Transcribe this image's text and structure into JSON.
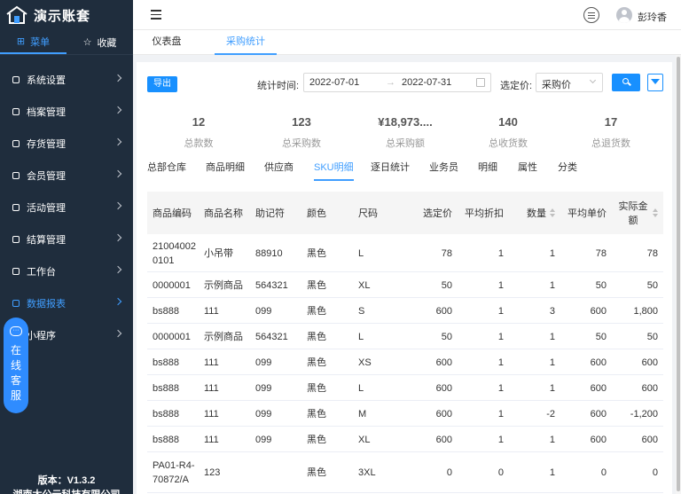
{
  "app": {
    "name": "演示账套",
    "version": "版本：V1.3.2",
    "company": "湖南太公云科技有限公司"
  },
  "sidebar": {
    "switch_tabs": [
      {
        "label": "菜单",
        "icon": "grid-icon",
        "active": true
      },
      {
        "label": "收藏",
        "icon": "star-icon",
        "active": false
      }
    ],
    "items": [
      {
        "label": "系统设置",
        "icon": "settings-icon"
      },
      {
        "label": "档案管理",
        "icon": "archive-icon"
      },
      {
        "label": "存货管理",
        "icon": "inventory-icon"
      },
      {
        "label": "会员管理",
        "icon": "member-icon"
      },
      {
        "label": "活动管理",
        "icon": "activity-icon"
      },
      {
        "label": "结算管理",
        "icon": "settlement-icon"
      },
      {
        "label": "工作台",
        "icon": "workbench-icon"
      },
      {
        "label": "数据报表",
        "icon": "report-icon",
        "active": true
      },
      {
        "label": "小程序",
        "icon": "miniapp-icon"
      }
    ],
    "service": "在线客服"
  },
  "header": {
    "username": "彭玲香"
  },
  "page_tabs": [
    {
      "label": "仪表盘",
      "active": false
    },
    {
      "label": "采购统计",
      "active": true
    }
  ],
  "toolbar": {
    "export_label": "导出",
    "time_label": "统计时间:",
    "start_date": "2022-07-01",
    "end_date": "2022-07-31",
    "arrow": "→",
    "price_label": "选定价:",
    "price_value": "采购价"
  },
  "stats": [
    {
      "value": "12",
      "label": "总款数"
    },
    {
      "value": "123",
      "label": "总采购数"
    },
    {
      "value": "¥18,973....",
      "label": "总采购额"
    },
    {
      "value": "140",
      "label": "总收货数"
    },
    {
      "value": "17",
      "label": "总退货数"
    }
  ],
  "sub_tabs": [
    {
      "label": "总部仓库",
      "active": false
    },
    {
      "label": "商品明细",
      "active": false
    },
    {
      "label": "供应商",
      "active": false
    },
    {
      "label": "SKU明细",
      "active": true
    },
    {
      "label": "逐日统计",
      "active": false
    },
    {
      "label": "业务员",
      "active": false
    },
    {
      "label": "明细",
      "active": false
    },
    {
      "label": "属性",
      "active": false
    },
    {
      "label": "分类",
      "active": false
    }
  ],
  "table": {
    "columns": [
      "商品编码",
      "商品名称",
      "助记符",
      "颜色",
      "尺码",
      "选定价",
      "平均折扣",
      "数量",
      "平均单价",
      "实际金额"
    ],
    "rows": [
      [
        "21004002 0101",
        "小吊带",
        "88910",
        "黑色",
        "L",
        "78",
        "1",
        "1",
        "78",
        "78"
      ],
      [
        "0000001",
        "示例商品",
        "564321",
        "黑色",
        "XL",
        "50",
        "1",
        "1",
        "50",
        "50"
      ],
      [
        "bs888",
        "111",
        "099",
        "黑色",
        "S",
        "600",
        "1",
        "3",
        "600",
        "1,800"
      ],
      [
        "0000001",
        "示例商品",
        "564321",
        "黑色",
        "L",
        "50",
        "1",
        "1",
        "50",
        "50"
      ],
      [
        "bs888",
        "111",
        "099",
        "黑色",
        "XS",
        "600",
        "1",
        "1",
        "600",
        "600"
      ],
      [
        "bs888",
        "111",
        "099",
        "黑色",
        "L",
        "600",
        "1",
        "1",
        "600",
        "600"
      ],
      [
        "bs888",
        "111",
        "099",
        "黑色",
        "M",
        "600",
        "1",
        "-2",
        "600",
        "-1,200"
      ],
      [
        "bs888",
        "111",
        "099",
        "黑色",
        "XL",
        "600",
        "1",
        "1",
        "600",
        "600"
      ],
      [
        "PA01-R4-70872/A",
        "123",
        "",
        "黑色",
        "3XL",
        "0",
        "0",
        "1",
        "0",
        "0"
      ]
    ]
  },
  "colors": {
    "sidebar_bg": "#1f2d3d",
    "accent": "#409eff",
    "primary_button": "#1890ff"
  }
}
